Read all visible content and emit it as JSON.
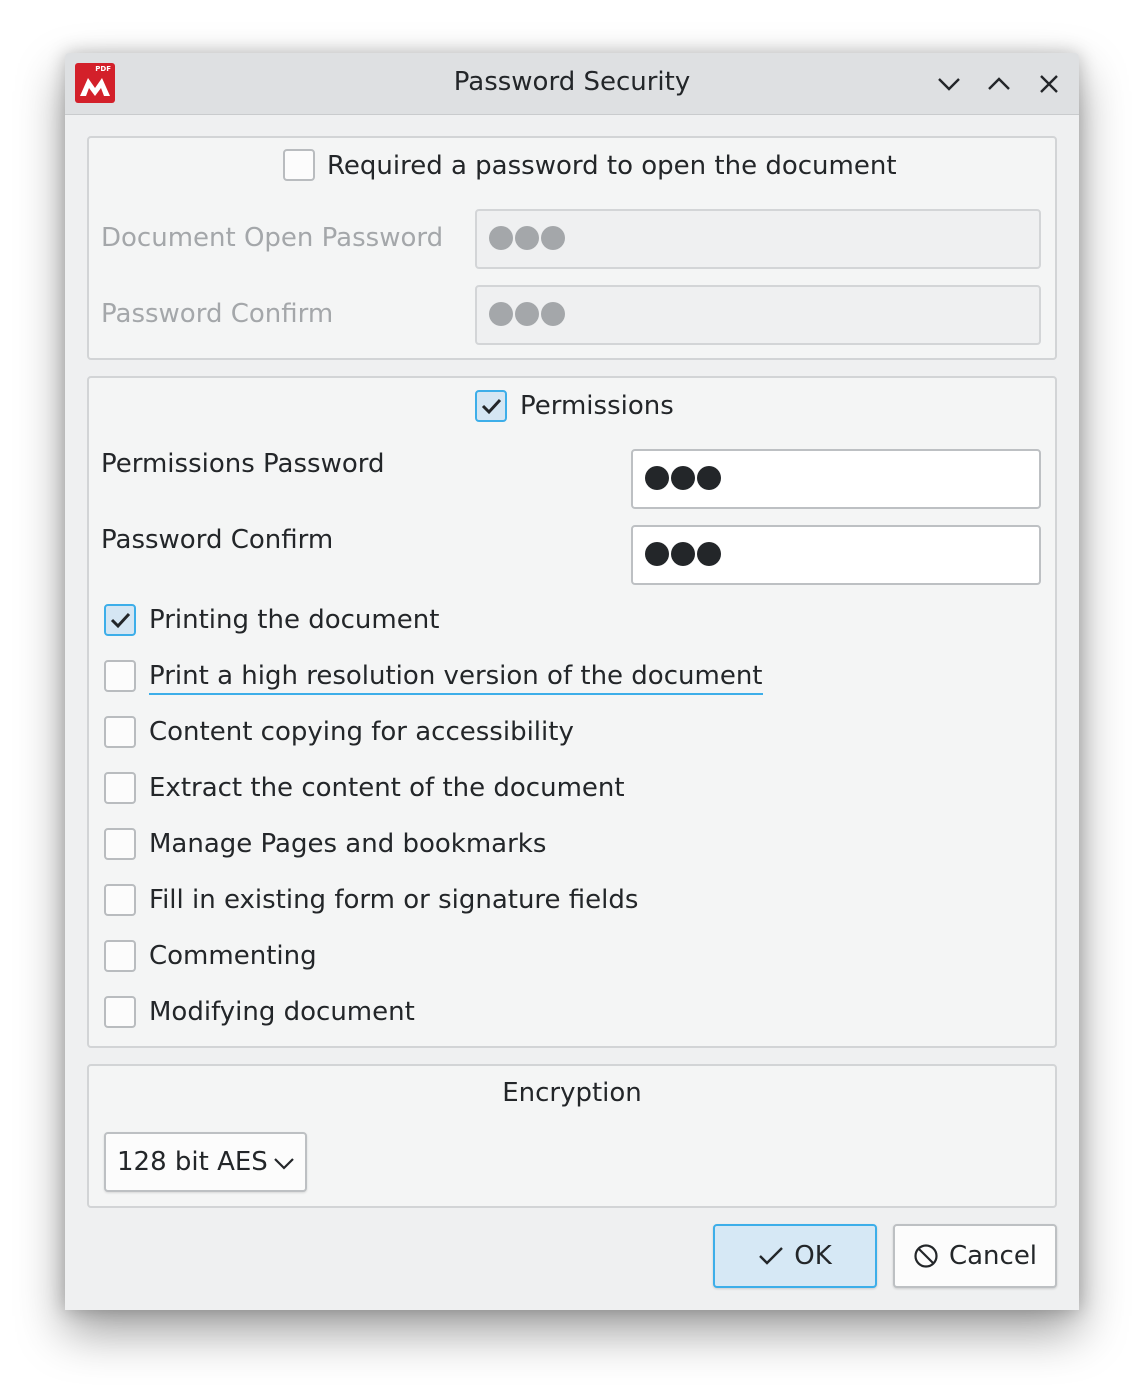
{
  "window": {
    "title": "Password Security"
  },
  "titlebar": {
    "app_icon_badge": "PDF",
    "buttons": [
      "minimize-icon",
      "maximize-icon",
      "close-icon"
    ]
  },
  "open_password": {
    "checkbox_label": "Required a password to open the document",
    "checked": false,
    "password_label": "Document Open Password",
    "confirm_label": "Password Confirm"
  },
  "permissions": {
    "checkbox_label": "Permissions",
    "checked": true,
    "password_label": "Permissions Password",
    "confirm_label": "Password Confirm",
    "options": [
      {
        "label": "Printing the document",
        "checked": true
      },
      {
        "label": "Print a high resolution version of the document",
        "checked": false
      },
      {
        "label": "Content copying for accessibility",
        "checked": false
      },
      {
        "label": "Extract the content of the document",
        "checked": false
      },
      {
        "label": "Manage Pages and bookmarks",
        "checked": false
      },
      {
        "label": "Fill in existing form or signature fields",
        "checked": false
      },
      {
        "label": "Commenting",
        "checked": false
      },
      {
        "label": "Modifying document",
        "checked": false
      }
    ]
  },
  "encryption": {
    "title": "Encryption",
    "selected": "128 bit AES"
  },
  "footer": {
    "ok_label": "OK",
    "cancel_label": "Cancel"
  },
  "colors": {
    "accent": "#3daee9",
    "window_bg": "#eff0f1",
    "app_icon": "#d3202a"
  }
}
